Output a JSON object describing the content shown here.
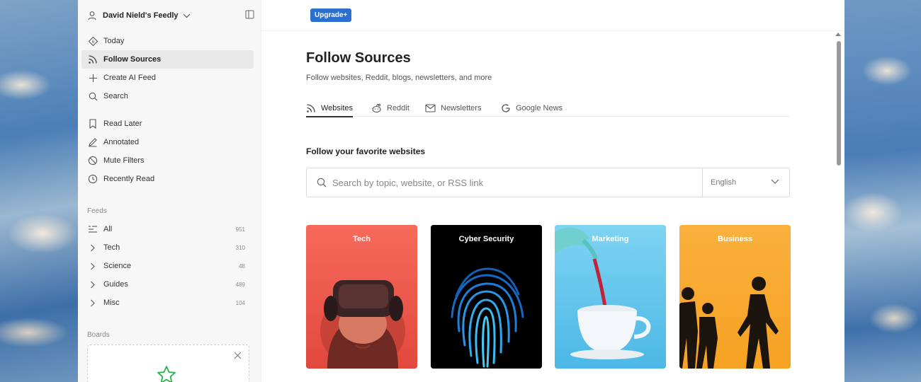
{
  "sidebar": {
    "user_name": "David Nield's Feedly",
    "nav": [
      {
        "label": "Today",
        "icon": "today-icon"
      },
      {
        "label": "Follow Sources",
        "icon": "rss-icon"
      },
      {
        "label": "Create AI Feed",
        "icon": "plus-icon"
      },
      {
        "label": "Search",
        "icon": "search-icon"
      }
    ],
    "saved": [
      {
        "label": "Read Later",
        "icon": "bookmark-icon"
      },
      {
        "label": "Annotated",
        "icon": "pen-icon"
      },
      {
        "label": "Mute Filters",
        "icon": "mute-icon"
      },
      {
        "label": "Recently Read",
        "icon": "clock-icon"
      }
    ],
    "feeds_label": "Feeds",
    "feeds": [
      {
        "label": "All",
        "count": "951"
      },
      {
        "label": "Tech",
        "count": "310"
      },
      {
        "label": "Science",
        "count": "48"
      },
      {
        "label": "Guides",
        "count": "489"
      },
      {
        "label": "Misc",
        "count": "104"
      }
    ],
    "boards_label": "Boards"
  },
  "topbar": {
    "upgrade_label": "Upgrade+"
  },
  "main": {
    "title": "Follow Sources",
    "subtitle": "Follow websites, Reddit, blogs, newsletters, and more",
    "tabs": [
      {
        "label": "Websites",
        "icon": "rss-icon"
      },
      {
        "label": "Reddit",
        "icon": "reddit-icon"
      },
      {
        "label": "Newsletters",
        "icon": "mail-icon"
      },
      {
        "label": "Google News",
        "icon": "google-icon"
      }
    ],
    "section_heading": "Follow your favorite websites",
    "search": {
      "placeholder": "Search by topic, website, or RSS link",
      "value": ""
    },
    "language": "English",
    "cards": [
      {
        "label": "Tech",
        "color": "#f0574c"
      },
      {
        "label": "Cyber Security",
        "color": "#000000"
      },
      {
        "label": "Marketing",
        "color": "#5fc3ea"
      },
      {
        "label": "Business",
        "color": "#f7a32a"
      }
    ]
  },
  "colors": {
    "accent": "#2d6fcf",
    "sidebar_bg": "#f7f7f7",
    "active_item_bg": "#e8e8e8"
  }
}
